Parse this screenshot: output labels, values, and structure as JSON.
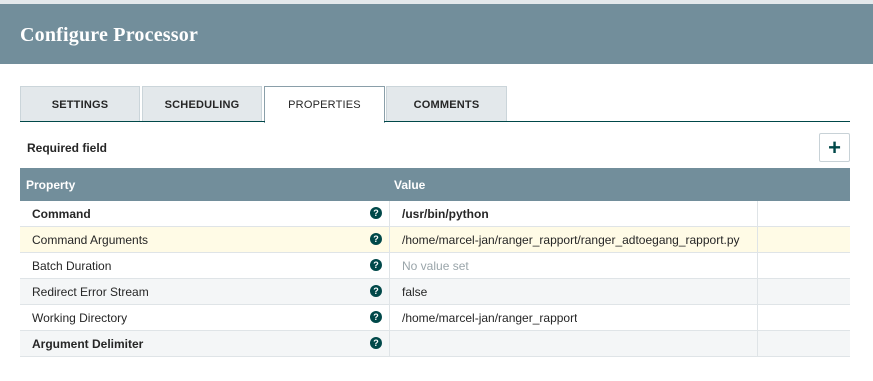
{
  "dialog": {
    "title": "Configure Processor"
  },
  "tabs": [
    {
      "label": "SETTINGS"
    },
    {
      "label": "SCHEDULING"
    },
    {
      "label": "PROPERTIES",
      "active": true
    },
    {
      "label": "COMMENTS"
    }
  ],
  "properties": {
    "required_label": "Required field",
    "add_icon": "plus-icon",
    "columns": {
      "property": "Property",
      "value": "Value"
    },
    "help_icon": "question-circle-icon",
    "help_glyph": "?",
    "rows": [
      {
        "name": "Command",
        "value": "/usr/bin/python",
        "required": true
      },
      {
        "name": "Command Arguments",
        "value": "/home/marcel-jan/ranger_rapport/ranger_adtoegang_rapport.py",
        "required": false,
        "highlighted": true
      },
      {
        "name": "Batch Duration",
        "value": "No value set",
        "required": false,
        "empty": true
      },
      {
        "name": "Redirect Error Stream",
        "value": "false",
        "required": false
      },
      {
        "name": "Working Directory",
        "value": "/home/marcel-jan/ranger_rapport",
        "required": false
      },
      {
        "name": "Argument Delimiter",
        "value": "",
        "required": true
      }
    ]
  },
  "colors": {
    "header": "#728e9b",
    "accent": "#004849",
    "highlight_row": "#fffbe6"
  }
}
